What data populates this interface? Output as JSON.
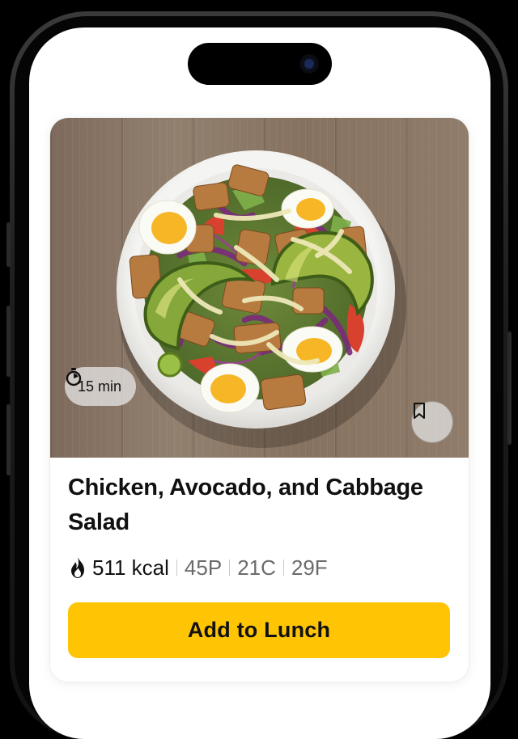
{
  "recipe_card": {
    "time_label": "15 min",
    "title": "Chicken, Avocado, and Cabbage Salad",
    "calories": "511 kcal",
    "protein": "45P",
    "carbs": "21C",
    "fat": "29F",
    "cta_label": "Add to Lunch",
    "bookmarked": false
  },
  "colors": {
    "accent": "#ffc505",
    "text": "#111111",
    "muted": "#6b6b6b"
  },
  "icons": {
    "timer": "stopwatch-icon",
    "calories": "flame-icon",
    "bookmark": "bookmark-icon"
  }
}
